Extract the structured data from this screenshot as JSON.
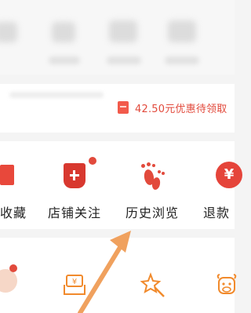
{
  "coupon": {
    "text": "42.50元优惠待领取"
  },
  "shortcuts": [
    {
      "label": "收藏",
      "icon": "favorites-icon"
    },
    {
      "label": "店铺关注",
      "icon": "store-follow-icon"
    },
    {
      "label": "历史浏览",
      "icon": "footprints-icon"
    },
    {
      "label": "退款",
      "icon": "refund-icon"
    }
  ],
  "refund_symbol": "¥",
  "bottom_icons": [
    {
      "icon": "avatar-icon"
    },
    {
      "icon": "wallet-icon",
      "symbol": "¥"
    },
    {
      "icon": "star-wand-icon"
    },
    {
      "icon": "cow-icon"
    }
  ],
  "colors": {
    "accent_red": "#e24a3c",
    "accent_orange": "#f18a2c",
    "arrow_orange": "#f0a15e"
  }
}
